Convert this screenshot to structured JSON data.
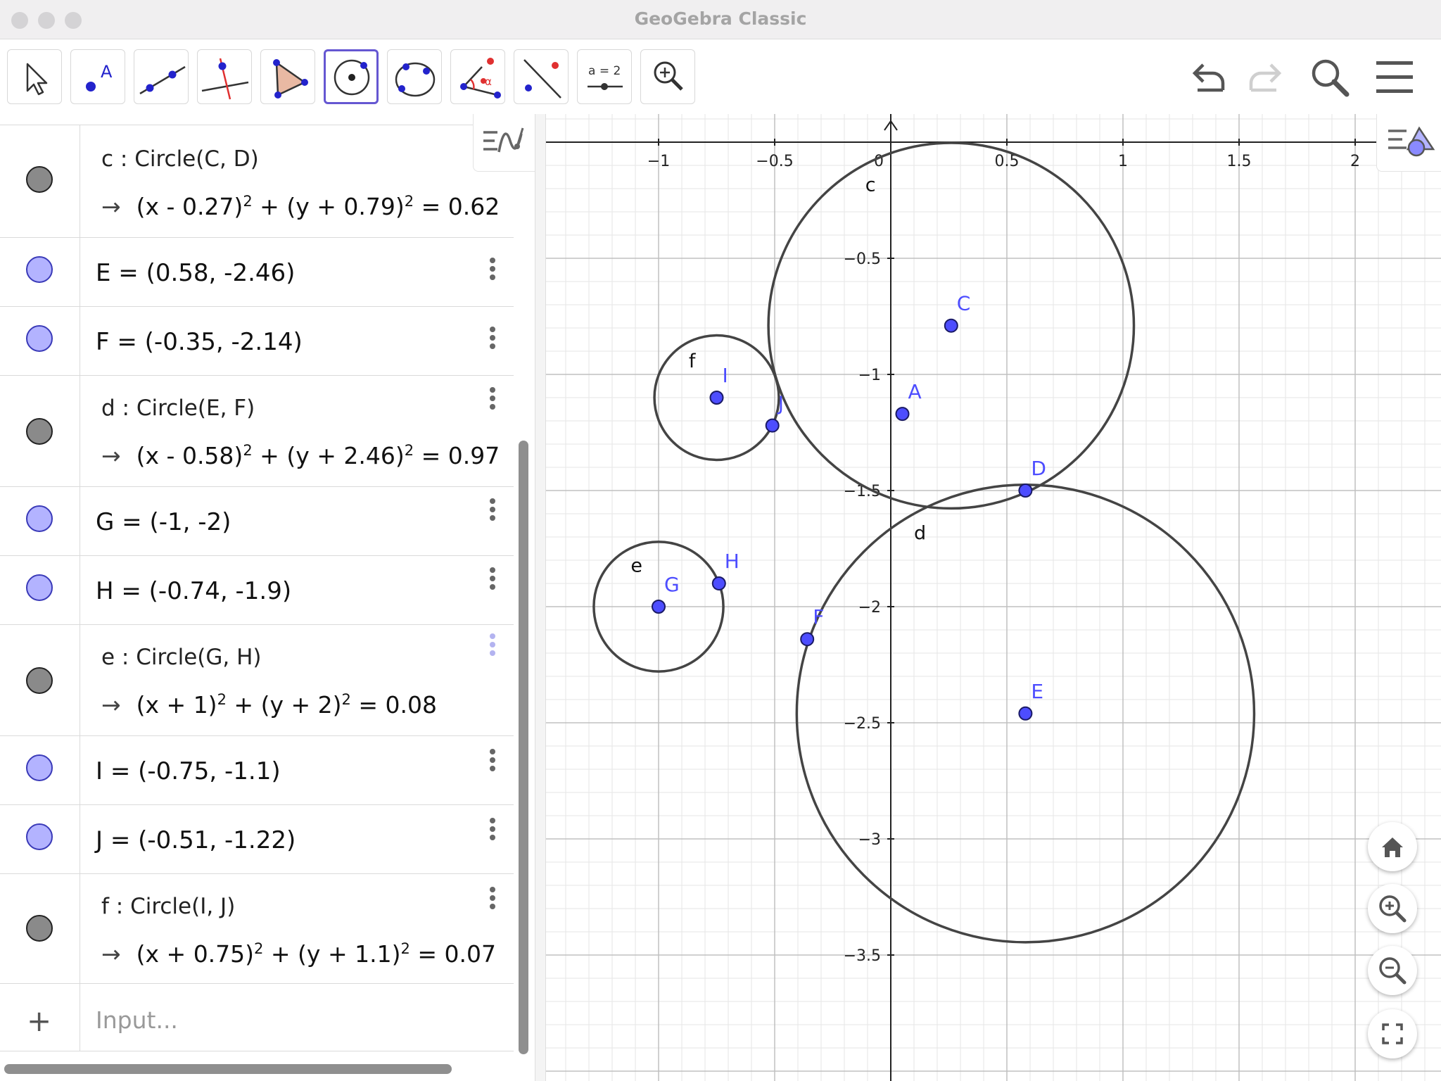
{
  "window": {
    "title": "GeoGebra Classic"
  },
  "toolbar": {
    "tools": [
      {
        "name": "move-tool",
        "icon": "arrow-cursor-icon"
      },
      {
        "name": "point-tool",
        "icon": "point-icon",
        "label": "A"
      },
      {
        "name": "line-tool",
        "icon": "line-through-points-icon"
      },
      {
        "name": "perpendicular-line-tool",
        "icon": "perpendicular-icon"
      },
      {
        "name": "polygon-tool",
        "icon": "polygon-icon"
      },
      {
        "name": "circle-center-point-tool",
        "icon": "circle-center-icon",
        "active": true
      },
      {
        "name": "circle-three-points-tool",
        "icon": "circle-three-points-icon"
      },
      {
        "name": "angle-tool",
        "icon": "angle-icon",
        "label": "α"
      },
      {
        "name": "reflect-tool",
        "icon": "reflect-icon"
      },
      {
        "name": "slider-tool",
        "icon": "slider-icon",
        "label": "a = 2"
      },
      {
        "name": "zoom-in-tool",
        "icon": "zoom-in-icon"
      }
    ],
    "right": [
      "undo-icon",
      "redo-icon",
      "search-icon",
      "menu-icon"
    ]
  },
  "algebra": {
    "items": [
      {
        "type": "circle",
        "def": "c : Circle(C, D)",
        "value_parts": [
          "(x - 0.27)",
          "2",
          " + (y + 0.79)",
          "2",
          " = 0.62"
        ]
      },
      {
        "type": "point",
        "text": "E = (0.58, -2.46)"
      },
      {
        "type": "point",
        "text": "F = (-0.35, -2.14)"
      },
      {
        "type": "circle",
        "def": "d : Circle(E, F)",
        "value_parts": [
          "(x - 0.58)",
          "2",
          " + (y + 2.46)",
          "2",
          " = 0.97"
        ]
      },
      {
        "type": "point",
        "text": "G = (-1, -2)"
      },
      {
        "type": "point",
        "text": "H = (-0.74, -1.9)"
      },
      {
        "type": "circle",
        "def": "e : Circle(G, H)",
        "value_parts": [
          "(x + 1)",
          "2",
          " + (y + 2)",
          "2",
          " = 0.08"
        ]
      },
      {
        "type": "point",
        "text": "I = (-0.75, -1.1)"
      },
      {
        "type": "point",
        "text": "J = (-0.51, -1.22)"
      },
      {
        "type": "circle",
        "def": "f : Circle(I, J)",
        "value_parts": [
          "(x + 0.75)",
          "2",
          " + (y + 1.1)",
          "2",
          " = 0.07"
        ]
      }
    ],
    "input_placeholder": "Input..."
  },
  "graphics": {
    "x_ticks": [
      {
        "v": -1,
        "label": "−1"
      },
      {
        "v": -0.5,
        "label": "−0.5"
      },
      {
        "v": 0,
        "label": "0"
      },
      {
        "v": 0.5,
        "label": "0.5"
      },
      {
        "v": 1,
        "label": "1"
      },
      {
        "v": 1.5,
        "label": "1.5"
      },
      {
        "v": 2,
        "label": "2"
      }
    ],
    "y_ticks": [
      {
        "v": -0.5,
        "label": "−0.5"
      },
      {
        "v": -1,
        "label": "−1"
      },
      {
        "v": -1.5,
        "label": "−1.5"
      },
      {
        "v": -2,
        "label": "−2"
      },
      {
        "v": -2.5,
        "label": "−2.5"
      },
      {
        "v": -3,
        "label": "−3"
      },
      {
        "v": -3.5,
        "label": "−3.5"
      }
    ],
    "points": [
      {
        "name": "A",
        "x": 0.05,
        "y": -1.17
      },
      {
        "name": "C",
        "x": 0.26,
        "y": -0.79
      },
      {
        "name": "D",
        "x": 0.58,
        "y": -1.5
      },
      {
        "name": "E",
        "x": 0.58,
        "y": -2.46
      },
      {
        "name": "F",
        "x": -0.36,
        "y": -2.14
      },
      {
        "name": "G",
        "x": -1,
        "y": -2
      },
      {
        "name": "H",
        "x": -0.74,
        "y": -1.9
      },
      {
        "name": "I",
        "x": -0.75,
        "y": -1.1
      },
      {
        "name": "J",
        "x": -0.51,
        "y": -1.22
      }
    ],
    "circles": [
      {
        "name": "c",
        "cx": 0.26,
        "cy": -0.79,
        "r": 0.787
      },
      {
        "name": "d",
        "cx": 0.58,
        "cy": -2.46,
        "r": 0.985
      },
      {
        "name": "e",
        "cx": -1,
        "cy": -2,
        "r": 0.279
      },
      {
        "name": "f",
        "cx": -0.75,
        "cy": -1.1,
        "r": 0.268
      }
    ],
    "colors": {
      "point_fill": "#4d4dff",
      "point_label": "#4d4dff",
      "circle_stroke": "#444444",
      "grid_major": "#c0c0c0",
      "grid_minor": "#e6e6e6"
    },
    "buttons": [
      "home-icon",
      "zoom-in-icon",
      "zoom-out-icon",
      "fullscreen-icon"
    ]
  }
}
